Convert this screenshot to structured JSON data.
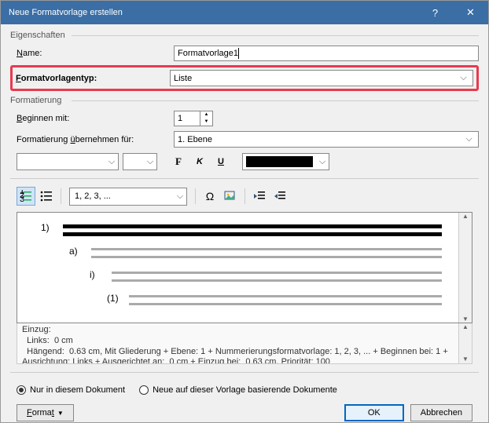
{
  "titlebar": {
    "title": "Neue Formatvorlage erstellen"
  },
  "groups": {
    "properties": "Eigenschaften",
    "formatting": "Formatierung"
  },
  "fields": {
    "name_label": "Name:",
    "name_value": "Formatvorlage1",
    "type_label": "Formatvorlagentyp:",
    "type_value": "Liste",
    "start_label": "Beginnen mit:",
    "start_value": "1",
    "apply_label": "Formatierung übernehmen für:",
    "apply_value": "1. Ebene"
  },
  "format": {
    "bold": "F",
    "italic": "K",
    "underline": "U",
    "number_format": "1, 2, 3, ...",
    "color": "#000000"
  },
  "preview": {
    "levels": [
      {
        "num": "1)",
        "indent": 0,
        "gray": false
      },
      {
        "num": "a)",
        "indent": 36,
        "gray": true
      },
      {
        "num": "i)",
        "indent": 62,
        "gray": true
      },
      {
        "num": "(1)",
        "indent": 84,
        "gray": true
      }
    ]
  },
  "description": {
    "line1": "Einzug:",
    "line2": "  Links:  0 cm",
    "line3": "  Hängend:  0.63 cm, Mit Gliederung + Ebene: 1 + Nummerierungsformatvorlage: 1, 2, 3, ... + Beginnen bei: 1 + Ausrichtung: Links + Ausgerichtet an:  0 cm + Einzug bei:  0.63 cm, Priorität: 100"
  },
  "radios": {
    "only_doc": "Nur in diesem Dokument",
    "new_based": "Neue auf dieser Vorlage basierende Dokumente"
  },
  "buttons": {
    "format": "Format",
    "ok": "OK",
    "cancel": "Abbrechen"
  }
}
